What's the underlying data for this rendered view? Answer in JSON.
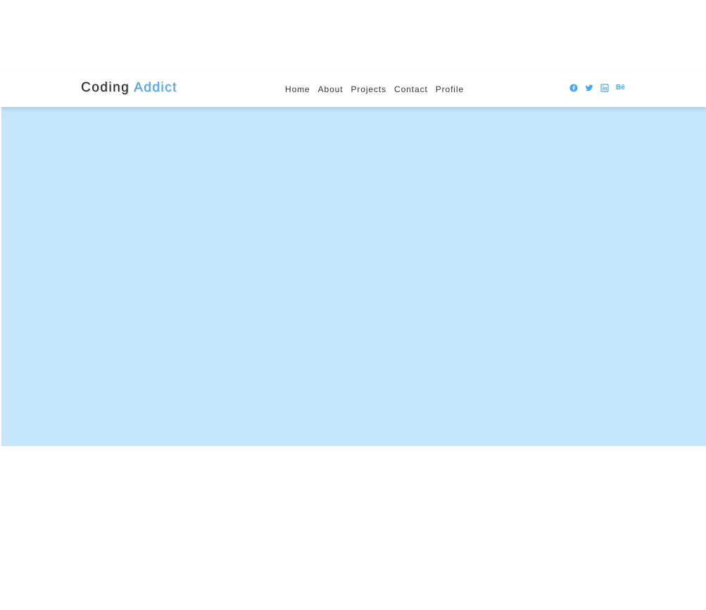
{
  "brand": {
    "name_part1": "Coding",
    "name_part2": "Addict"
  },
  "nav": {
    "links": [
      "Home",
      "About",
      "Projects",
      "Contact",
      "Profile"
    ]
  },
  "social": {
    "icons": [
      "facebook-icon",
      "twitter-icon",
      "linkedin-icon",
      "behance-icon"
    ],
    "behance_label": "Bē"
  },
  "colors": {
    "accent": "#49a6e9",
    "hero_background": "#c5e5fb",
    "text": "#333333",
    "navbar_background": "#ffffff"
  }
}
